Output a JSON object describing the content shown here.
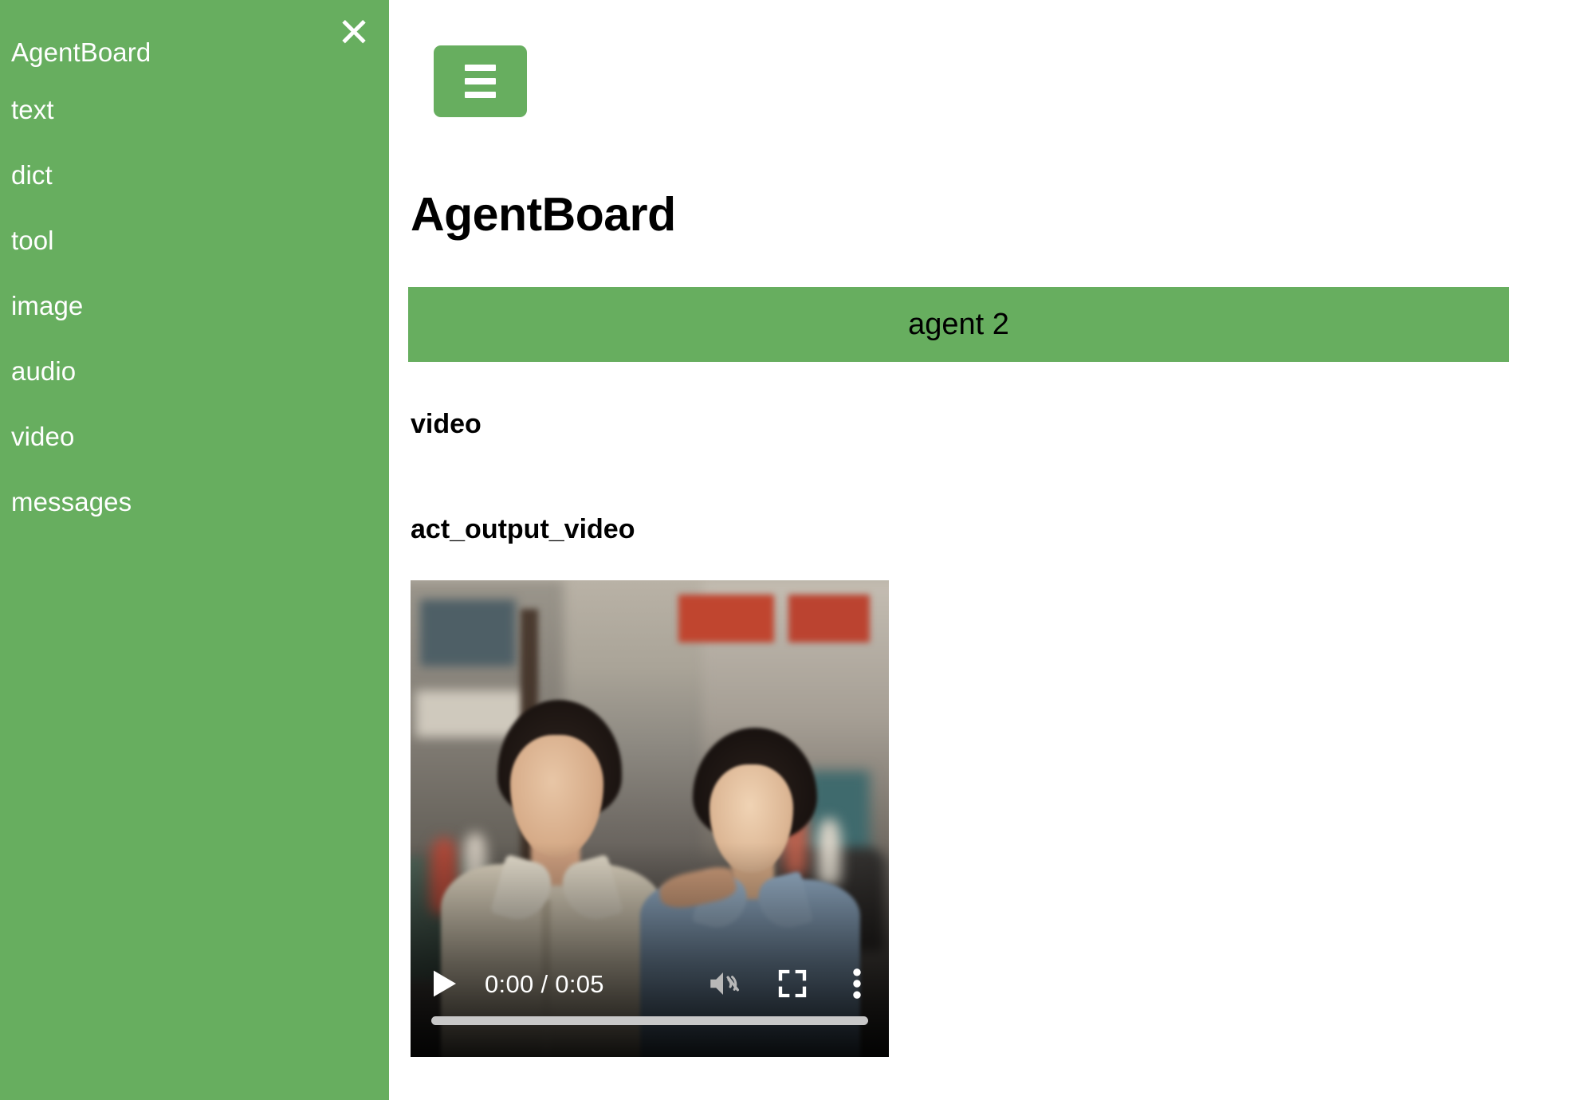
{
  "theme": {
    "brand_green": "#67ae5f",
    "text_dark": "#000000",
    "sidebar_text": "#ffffff",
    "video_bg": "#000000",
    "progress_track": "#c8c8c8"
  },
  "sidebar": {
    "close_icon": "close-icon",
    "items": [
      {
        "label": "AgentBoard",
        "icon": "brand-label"
      },
      {
        "label": "text",
        "icon": "text-nav"
      },
      {
        "label": "dict",
        "icon": "dict-nav"
      },
      {
        "label": "tool",
        "icon": "tool-nav"
      },
      {
        "label": "image",
        "icon": "image-nav"
      },
      {
        "label": "audio",
        "icon": "audio-nav"
      },
      {
        "label": "video",
        "icon": "video-nav"
      },
      {
        "label": "messages",
        "icon": "messages-nav"
      }
    ]
  },
  "main": {
    "hamburger_icon": "hamburger-icon",
    "page_title": "AgentBoard",
    "agent_tab": {
      "label": "agent 2"
    },
    "sections": [
      {
        "heading": "video"
      },
      {
        "heading": "act_output_video"
      }
    ]
  },
  "video_player": {
    "play_icon": "play-icon",
    "time_display": "0:00 / 0:05",
    "current_time": "0:00",
    "duration": "0:05",
    "mute_icon": "muted-volume-icon",
    "fullscreen_icon": "fullscreen-icon",
    "overflow_icon": "more-options-icon",
    "progress_percent": 0,
    "poster_description": "Two women standing together on a city street with red storefront signs in the background"
  }
}
